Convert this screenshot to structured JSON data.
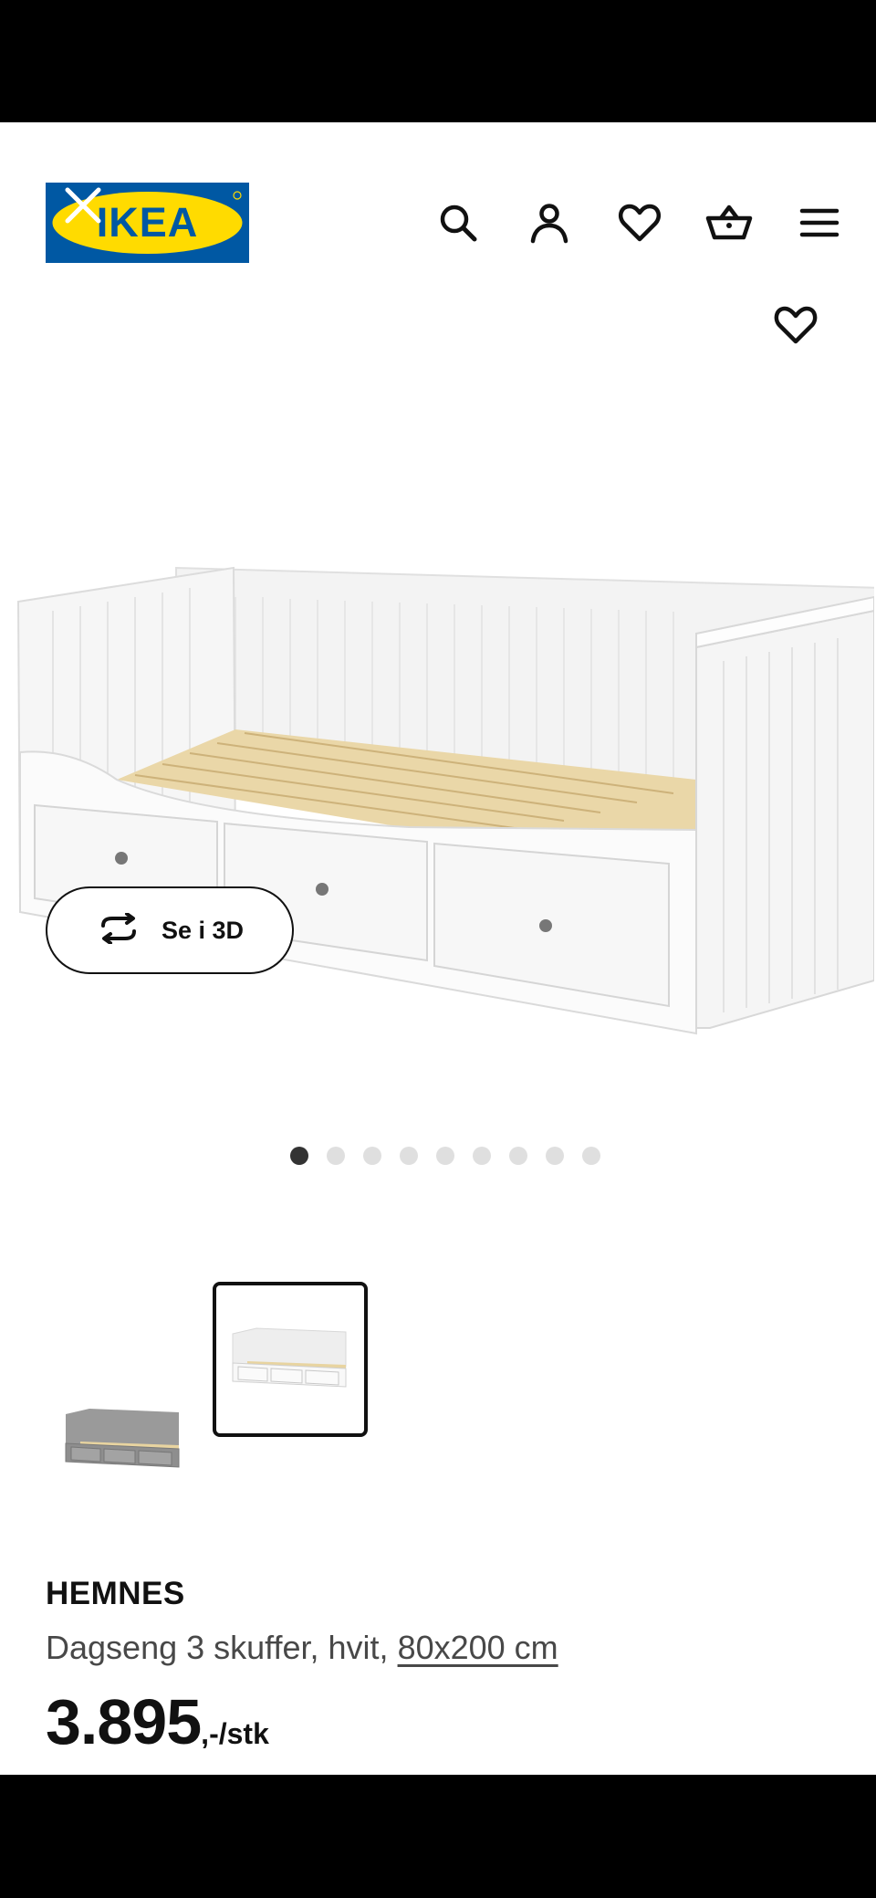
{
  "brand": {
    "logo_text": "IKEA"
  },
  "header": {
    "icons": [
      "search-icon",
      "account-icon",
      "wishlist-heart-icon",
      "basket-icon",
      "menu-icon"
    ]
  },
  "gallery": {
    "view_3d_label": "Se i 3D",
    "dot_count": 9,
    "active_dot": 1,
    "thumbnails": [
      {
        "variant": "grey",
        "selected": false
      },
      {
        "variant": "white",
        "selected": true
      }
    ]
  },
  "product": {
    "name": "HEMNES",
    "description": "Dagseng 3 skuffer, hvit, ",
    "size_link": "80x200 cm",
    "price_integer": "3.895",
    "price_suffix": ",-/stk"
  },
  "colors": {
    "ikea_blue": "#0058A3",
    "ikea_yellow": "#FFDB00",
    "text_dark": "#111111",
    "text_muted": "#484848"
  }
}
